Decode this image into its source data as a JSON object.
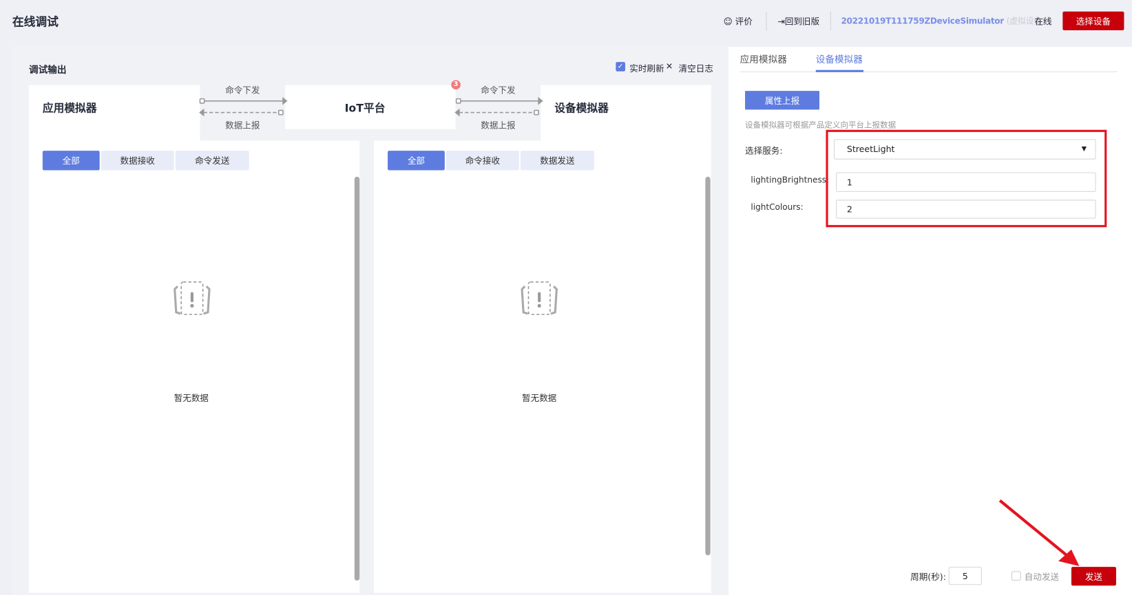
{
  "header": {
    "title": "在线调试",
    "rate_label": "评价",
    "old_version_label": "回到旧版",
    "device_name": "20221019T111759ZDeviceSimulator",
    "device_type": "(虚拟设备)",
    "status": "在线",
    "select_device_label": "选择设备"
  },
  "output": {
    "title": "调试输出",
    "realtime_label": "实时刷新",
    "realtime_checked": true,
    "clear_label": "清空日志"
  },
  "flow": {
    "app_simulator": "应用模拟器",
    "platform": "IoT平台",
    "device_simulator": "设备模拟器",
    "cmd_down": "命令下发",
    "data_up": "数据上报",
    "badge": "3"
  },
  "app_panel": {
    "tabs": [
      "全部",
      "数据接收",
      "命令发送"
    ],
    "active": 0,
    "empty": "暂无数据"
  },
  "device_panel": {
    "tabs": [
      "全部",
      "命令接收",
      "数据发送"
    ],
    "active": 0,
    "empty": "暂无数据"
  },
  "side": {
    "tabs": [
      "应用模拟器",
      "设备模拟器"
    ],
    "active": 1,
    "report_button": "属性上报",
    "hint": "设备模拟器可根据产品定义向平台上报数据",
    "service_label": "选择服务:",
    "service_value": "StreetLight",
    "fields": [
      {
        "label": "lightingBrightness:",
        "value": "1"
      },
      {
        "label": "lightColours:",
        "value": "2"
      }
    ],
    "period_label": "周期(秒):",
    "period_value": "5",
    "auto_send_label": "自动发送",
    "auto_send_checked": false,
    "send_label": "发送"
  },
  "colors": {
    "primary": "#5e7ce0",
    "danger": "#c7000b",
    "annotation": "#e4141e"
  }
}
